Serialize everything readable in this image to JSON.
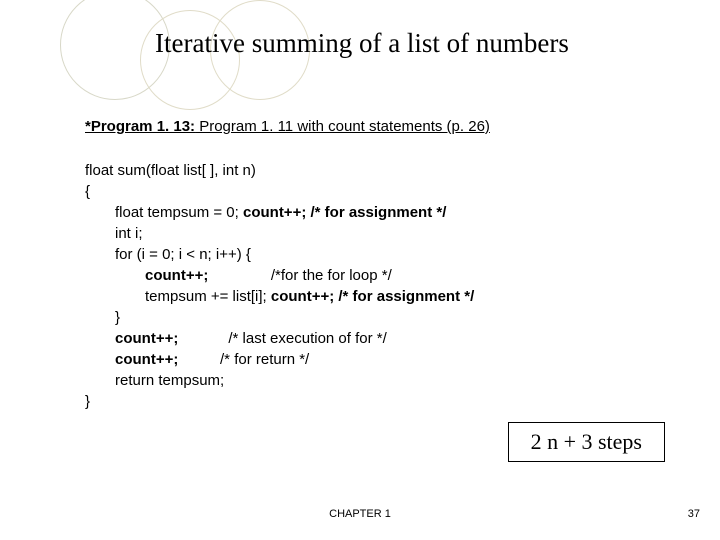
{
  "title": "Iterative summing of a list of numbers",
  "subtitle_bold": "*Program 1. 13:",
  "subtitle_rest": " Program 1. 11 with count statements (p. 26)",
  "code": {
    "l1": "float sum(float list[ ], int n)",
    "l2": "{",
    "l3a": "float tempsum = 0; ",
    "l3b": "count++;",
    "l3c": " /* for assignment */",
    "l4": "int i;",
    "l5": "for (i = 0; i < n; i++) {",
    "l6a": "count++;",
    "l6b": "               /*for the for loop */",
    "l7a": "tempsum += list[i]; ",
    "l7b": "count++;",
    "l7c": " /* for assignment */",
    "l8": "}",
    "l9a": "count++;",
    "l9b": "            /* last execution of for */",
    "l10": "",
    "l11a": "count++;",
    "l11b": "          /* for return */",
    "l12": "return tempsum;",
    "l13": "}"
  },
  "result": "2 n + 3 steps",
  "footer_chapter": "CHAPTER 1",
  "footer_page": "37"
}
